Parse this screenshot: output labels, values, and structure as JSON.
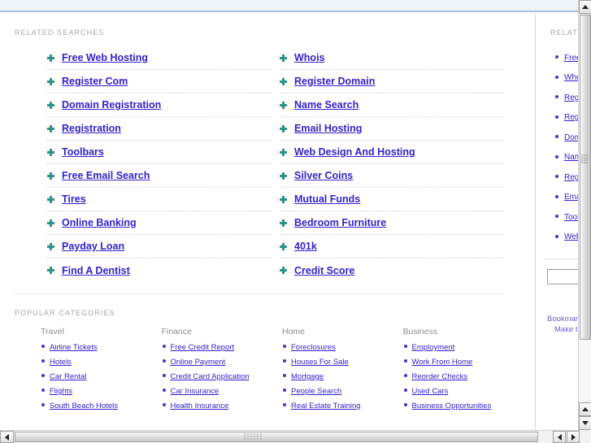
{
  "sections": {
    "related_searches_label": "RELATED SEARCHES",
    "popular_categories_label": "POPULAR CATEGORIES",
    "side_related_label": "RELATED"
  },
  "related_searches": [
    "Free Web Hosting",
    "Whois",
    "Register Com",
    "Register Domain",
    "Domain Registration",
    "Name Search",
    "Registration",
    "Email Hosting",
    "Toolbars",
    "Web Design And Hosting",
    "Free Email Search",
    "Silver Coins",
    "Tires",
    "Mutual Funds",
    "Online Banking",
    "Bedroom Furniture",
    "Payday Loan",
    "401k",
    "Find A Dentist",
    "Credit Score"
  ],
  "popular_categories": [
    {
      "title": "Travel",
      "items": [
        "Airline Tickets",
        "Hotels",
        "Car Rental",
        "Flights",
        "South Beach Hotels"
      ]
    },
    {
      "title": "Finance",
      "items": [
        "Free Credit Report",
        "Online Payment",
        "Credit Card Application",
        "Car Insurance",
        "Health Insurance"
      ]
    },
    {
      "title": "Home",
      "items": [
        "Foreclosures",
        "Houses For Sale",
        "Mortgage",
        "People Search",
        "Real Estate Training"
      ]
    },
    {
      "title": "Business",
      "items": [
        "Employment",
        "Work From Home",
        "Reorder Checks",
        "Used Cars",
        "Business Opportunities"
      ]
    }
  ],
  "side_panel": {
    "items": [
      "Free Web Hosting",
      "Whois",
      "Register Com",
      "Register Domain",
      "Domain Registration",
      "Name Search",
      "Registration",
      "Email Hosting",
      "Toolbars",
      "Web Design And Hosting"
    ],
    "search_value": "",
    "search_placeholder": "",
    "footer_line1": "Bookmark",
    "footer_line2": "Make this"
  },
  "colors": {
    "link": "#3322cc",
    "bullet_plus": "#2e9183",
    "bullet_dot": "#4136c9",
    "label_grey": "#a8a8a8",
    "top_strip_bg": "#eff4f8",
    "top_strip_border": "#a7c2de"
  },
  "scrollbars": {
    "v_up_icon": "triangle-up-icon",
    "v_down_icon": "triangle-down-icon",
    "h_left_icon": "triangle-left-icon",
    "h_right_icon": "triangle-right-icon"
  }
}
